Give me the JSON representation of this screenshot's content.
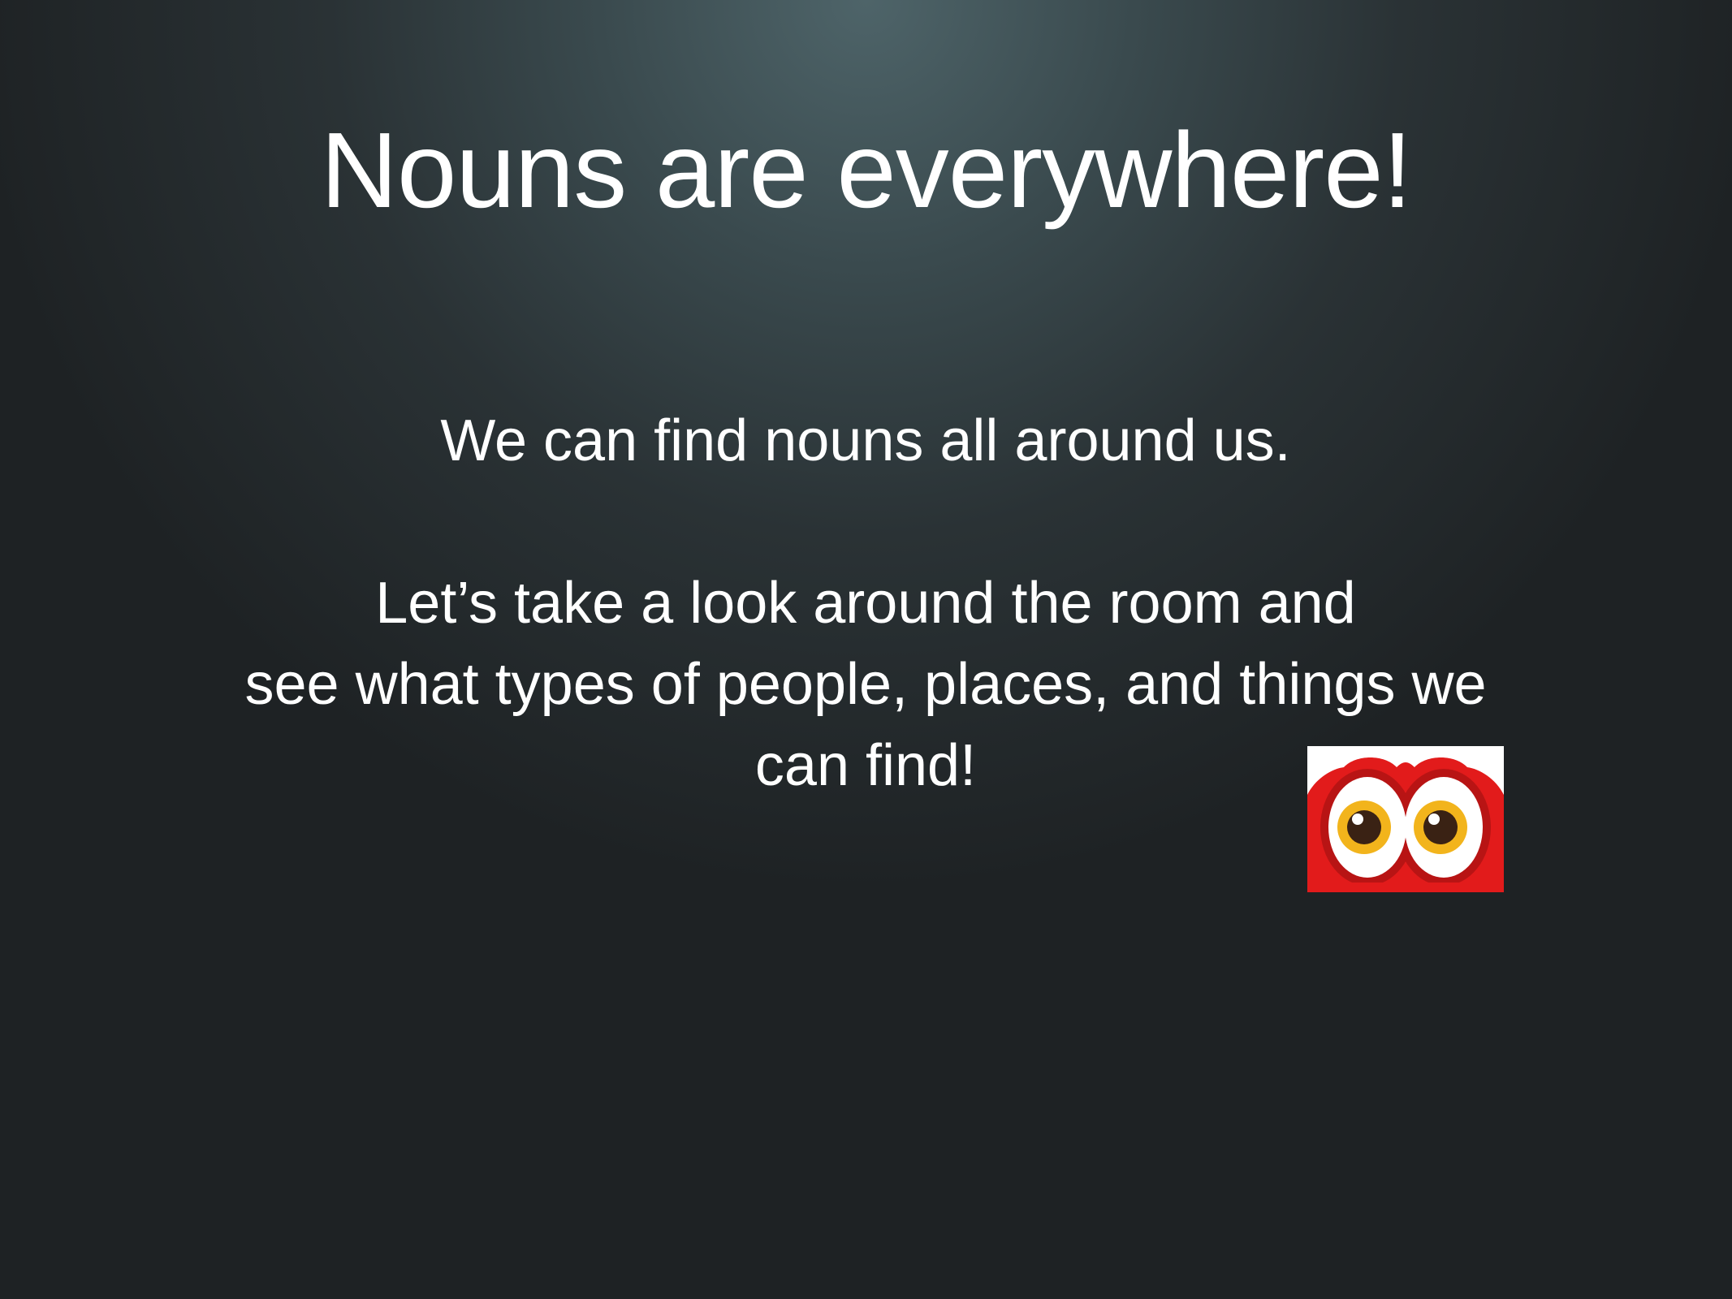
{
  "slide": {
    "title": "Nouns are everywhere!",
    "line1": "We can find nouns all around us.",
    "para2": [
      "Let’s take a look around the room and",
      "see what types of people, places, and things we",
      "can find!"
    ],
    "image_icon": "cartoon-eyes-icon"
  },
  "colors": {
    "text": "#ffffff",
    "background_center": "#4e6469",
    "background_edge": "#1e2224",
    "icon_red": "#e21b1b",
    "icon_iris": "#f2b41c",
    "icon_pupil": "#3a2214"
  }
}
